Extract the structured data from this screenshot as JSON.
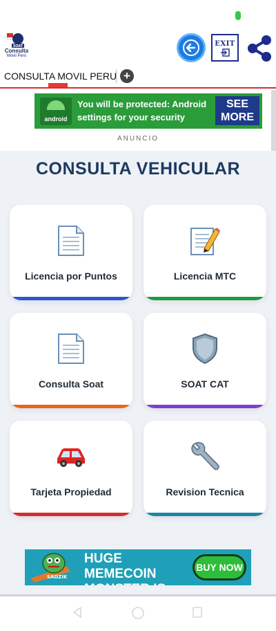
{
  "header": {
    "logo_text": "Consulta",
    "logo_sub": "Movil Perú",
    "logo_badge": "SOAT",
    "exit_label": "EXIT"
  },
  "tabs": [
    {
      "label": "CONSULTA MOVIL PERU",
      "active": true
    }
  ],
  "top_ad": {
    "text": "You will be protected: Android settings for your security",
    "brand": "android",
    "cta": "SEE MORE",
    "caption": "ANUNCIO"
  },
  "page_title": "CONSULTA VEHICULAR",
  "cards": [
    {
      "label": "Licencia por Puntos",
      "icon": "document-icon",
      "accent": "#2f55d4"
    },
    {
      "label": "Licencia MTC",
      "icon": "memo-pencil-icon",
      "accent": "#1e9a3f"
    },
    {
      "label": "Consulta Soat",
      "icon": "document-icon",
      "accent": "#e8651a"
    },
    {
      "label": "SOAT CAT",
      "icon": "shield-icon",
      "accent": "#7b3fd4"
    },
    {
      "label": "Tarjeta Propiedad",
      "icon": "car-icon",
      "accent": "#d62d2d"
    },
    {
      "label": "Revision Tecnica",
      "icon": "wrench-icon",
      "accent": "#1c86a8"
    }
  ],
  "bottom_ad": {
    "text": "HUGE MEMECOIN MONSTER IS HERE",
    "cta": "BUY NOW",
    "tag": "SADZIK"
  },
  "colors": {
    "title": "#1c3a5e",
    "tab_underline": "#d32f2f",
    "background": "#eef1f6"
  }
}
